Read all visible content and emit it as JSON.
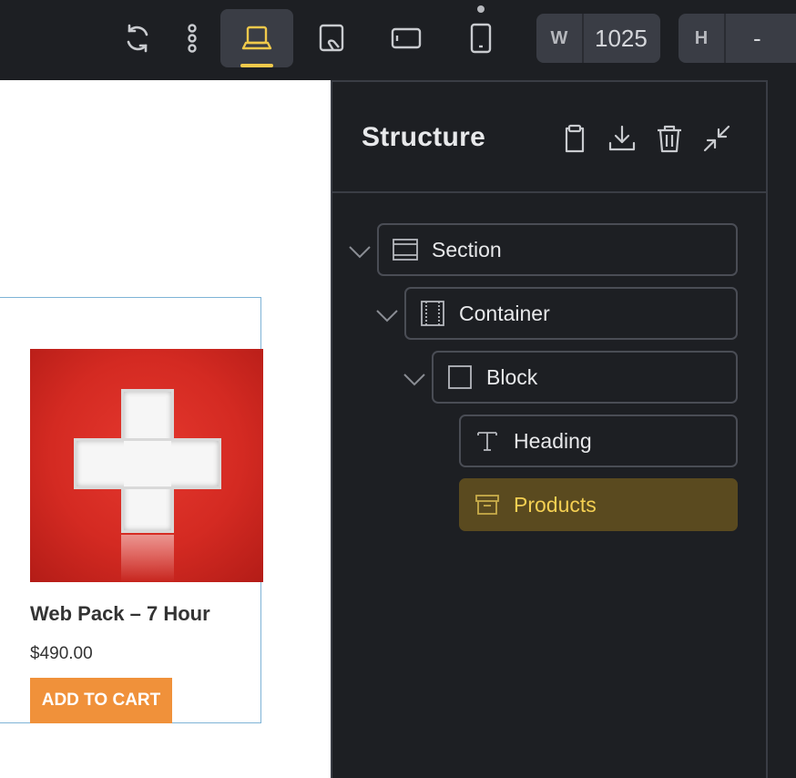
{
  "toolbar": {
    "icons": [
      "refresh-icon",
      "more-vertical-icon",
      "laptop-icon",
      "tablet-landscape-icon",
      "tablet-icon",
      "mobile-icon"
    ],
    "active_device": "laptop",
    "width_label": "W",
    "width_value": "1025",
    "height_label": "H",
    "height_value": "-",
    "accent_color": "#f0c94b"
  },
  "canvas": {
    "product": {
      "title": "Web Pack – 7 Hour",
      "price": "$490.00",
      "button_label": "ADD TO CART",
      "button_color": "#f0913a"
    }
  },
  "structure": {
    "title": "Structure",
    "header_icons": [
      "clipboard-icon",
      "download-icon",
      "trash-icon",
      "collapse-icon"
    ],
    "tree": [
      {
        "label": "Section",
        "icon": "section-icon",
        "expanded": true
      },
      {
        "label": "Container",
        "icon": "container-icon",
        "expanded": true
      },
      {
        "label": "Block",
        "icon": "block-icon",
        "expanded": true
      },
      {
        "label": "Heading",
        "icon": "text-icon"
      },
      {
        "label": "Products",
        "icon": "archive-icon",
        "selected": true
      }
    ],
    "selected_color": "#f4cf52"
  }
}
